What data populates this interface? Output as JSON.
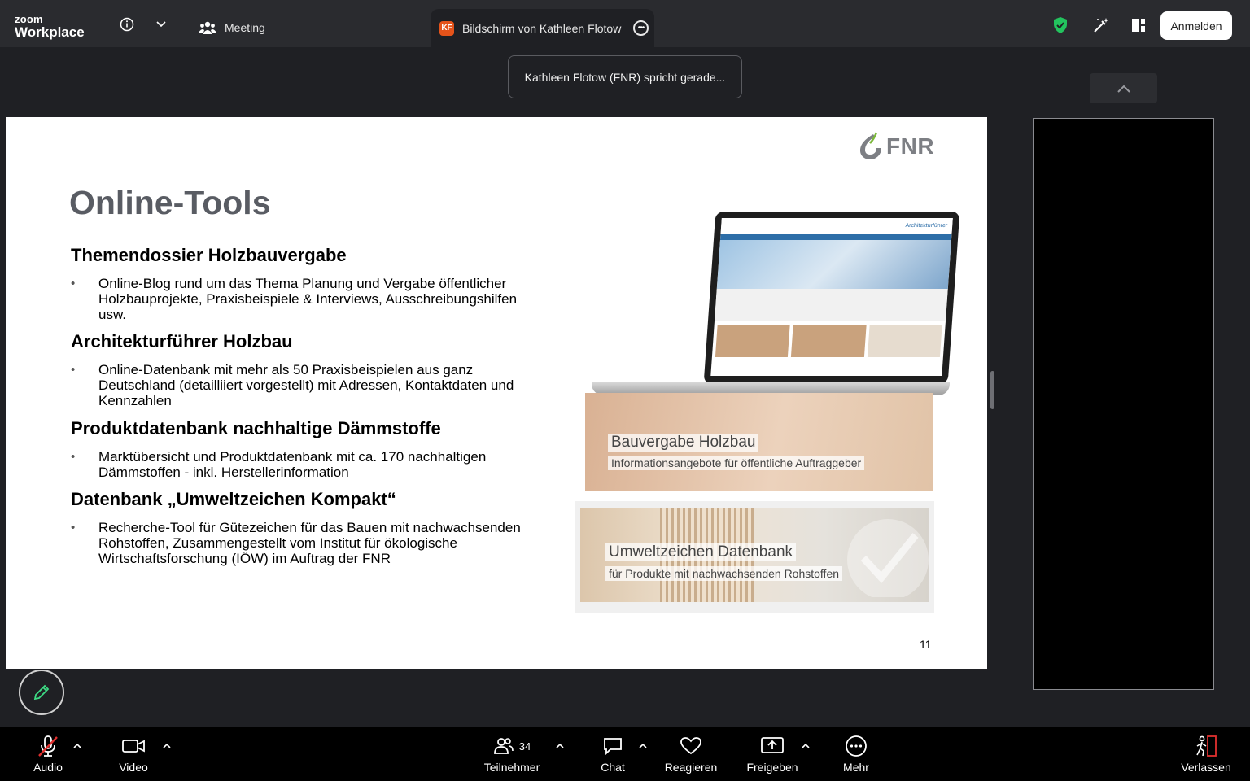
{
  "app": {
    "logo_line1": "zoom",
    "logo_line2": "Workplace"
  },
  "topbar": {
    "meeting_label": "Meeting",
    "share_badge": "KF",
    "share_title": "Bildschirm von Kathleen Flotow (F",
    "signin_label": "Anmelden"
  },
  "speaker_toast": "Kathleen Flotow (FNR) spricht gerade...",
  "slide": {
    "logo_text": "FNR",
    "title": "Online-Tools",
    "sections": [
      {
        "heading": "Themendossier Holzbauvergabe",
        "bullet": "Online-Blog rund um das Thema Planung und Vergabe öffentlicher Holzbauprojekte, Praxisbeispiele & Interviews, Ausschreibungshilfen usw."
      },
      {
        "heading": "Architekturführer Holzbau",
        "bullet": "Online-Datenbank mit mehr als 50 Praxisbeispielen aus ganz Deutschland (detailliiert vorgestellt) mit Adressen, Kontaktdaten und Kennzahlen"
      },
      {
        "heading": "Produktdatenbank nachhaltige Dämmstoffe",
        "bullet": "Marktübersicht und Produktdatenbank mit ca. 170 nachhaltigen Dämmstoffen - inkl. Herstellerinformation"
      },
      {
        "heading": "Datenbank „Umweltzeichen Kompakt“",
        "bullet": "Recherche-Tool für Gütezeichen für das Bauen mit nachwachsenden Rohstoffen, Zusammengestellt vom Institut für ökologische Wirtschaftsforschung (IÖW) im Auftrag der FNR"
      }
    ],
    "card1_title": "Bauvergabe Holzbau",
    "card1_sub": "Informationsangebote für öffentliche Auftraggeber",
    "card2_title": "Umweltzeichen Datenbank",
    "card2_sub": "für Produkte mit nachwachsenden Rohstoffen",
    "screen_title": "Architekturführer",
    "page_number": "11"
  },
  "toolbar": {
    "audio": "Audio",
    "video": "Video",
    "participants": "Teilnehmer",
    "participants_count": "34",
    "chat": "Chat",
    "react": "Reagieren",
    "share": "Freigeben",
    "more": "Mehr",
    "leave": "Verlassen"
  },
  "colors": {
    "shield": "#23c35e",
    "leave": "#e0302f",
    "mute_slash": "#e0302f",
    "pen": "#3ddc84"
  }
}
